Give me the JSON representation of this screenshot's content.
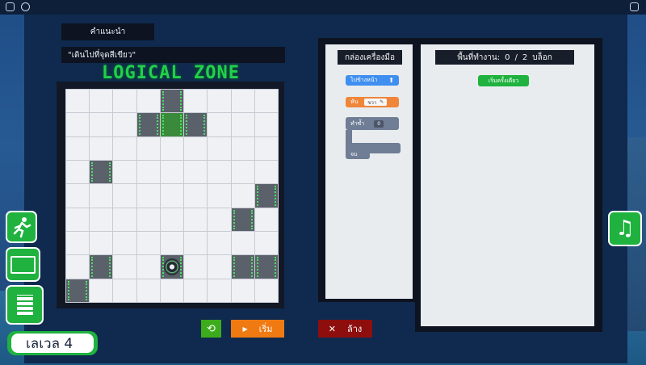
{
  "hint": {
    "label": "คำแนะนำ",
    "text": "\"เดินไปที่จุดสีเขียว\""
  },
  "game_title": "LOGICAL ZONE",
  "board": {
    "rows": 9,
    "cols": 9,
    "dark_cells": [
      [
        0,
        4
      ],
      [
        1,
        3
      ],
      [
        1,
        5
      ],
      [
        3,
        1
      ],
      [
        4,
        8
      ],
      [
        5,
        7
      ],
      [
        7,
        1
      ],
      [
        7,
        7
      ],
      [
        7,
        8
      ],
      [
        8,
        0
      ]
    ],
    "green_cells": [
      [
        1,
        4
      ]
    ],
    "robot_cell": [
      7,
      4
    ]
  },
  "toolbox": {
    "header": "กล่องเครื่องมือ",
    "blocks": [
      {
        "label": "ไปข้างหน้า",
        "icon": "up-arrow-icon",
        "color": "#3f8ff0"
      },
      {
        "label": "หัน",
        "value": "ขวา",
        "color": "#f0863a"
      },
      {
        "label": "ทำซ้ำ",
        "value": "0",
        "end_label": "จบ",
        "color": "#6f7d95"
      }
    ]
  },
  "workspace": {
    "header_prefix": "พื้นที่ทำงาน:",
    "used": "0",
    "separator": "/",
    "limit": "2",
    "unit": "บล็อก",
    "start_block": "เริ่มครั้งเดียว"
  },
  "controls": {
    "reset_icon": "reload-icon",
    "run_label": "เริ่ม",
    "clear_label": "ล้าง"
  },
  "level_label": "เลเวล 4",
  "side_buttons": [
    "run-mode-icon",
    "screen-icon",
    "notes-icon"
  ],
  "music_icon": "music-note-icon",
  "colors": {
    "accent_green": "#1fb23f",
    "run_orange": "#f07a12",
    "clear_red": "#8e0e0e"
  }
}
